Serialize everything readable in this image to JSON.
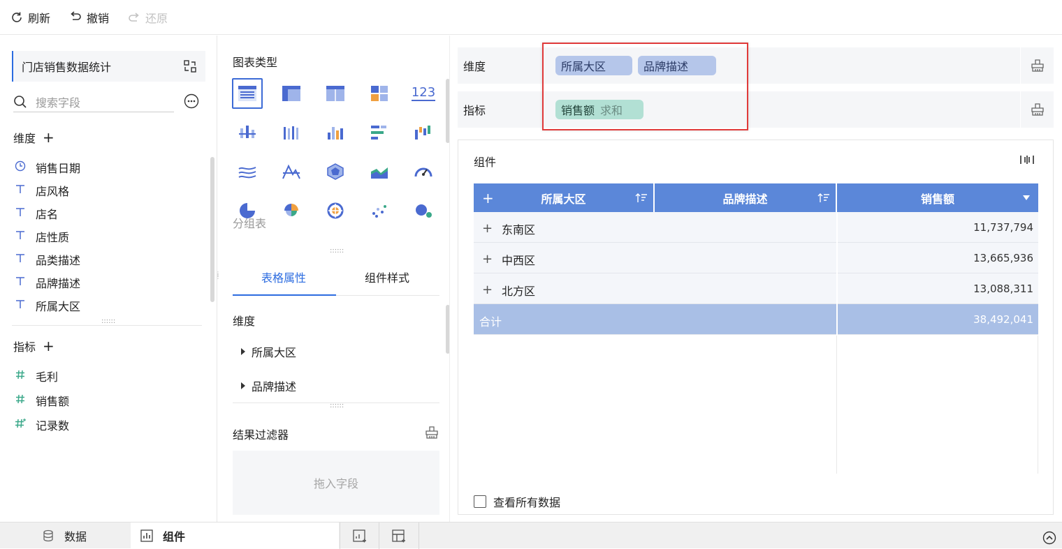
{
  "toolbar": {
    "refresh": "刷新",
    "undo": "撤销",
    "redo": "还原"
  },
  "dataset": {
    "title": "门店销售数据统计",
    "search_placeholder": "搜索字段"
  },
  "dimensions": {
    "label": "维度",
    "fields": [
      {
        "name": "销售日期",
        "icon": "clock-icon"
      },
      {
        "name": "店风格",
        "icon": "text-type-icon"
      },
      {
        "name": "店名",
        "icon": "text-type-icon"
      },
      {
        "name": "店性质",
        "icon": "text-type-icon"
      },
      {
        "name": "品类描述",
        "icon": "text-type-icon"
      },
      {
        "name": "品牌描述",
        "icon": "text-type-icon"
      },
      {
        "name": "所属大区",
        "icon": "text-type-icon"
      }
    ]
  },
  "measures": {
    "label": "指标",
    "fields": [
      {
        "name": "毛利",
        "icon": "number-type-icon"
      },
      {
        "name": "销售额",
        "icon": "number-type-icon"
      },
      {
        "name": "记录数",
        "icon": "count-type-icon"
      }
    ]
  },
  "chart_types": {
    "title": "图表类型",
    "tooltip": "分组表",
    "types": [
      "grouped-table",
      "cross-table",
      "detail-table",
      "kpi-card",
      "number-text",
      "grouped-bar",
      "stacked-column",
      "multi-series-column",
      "horizontal-bar",
      "waterfall",
      "area-line",
      "radial-line",
      "radar",
      "area",
      "gauge",
      "pie",
      "rose-pie",
      "multi-pie",
      "scatter",
      "bubble"
    ],
    "number_label": "123"
  },
  "prop_tabs": {
    "active": "表格属性",
    "other": "组件样式"
  },
  "props": {
    "dimension_label": "维度",
    "tree": [
      "所属大区",
      "品牌描述"
    ],
    "filter_label": "结果过滤器",
    "drop_placeholder": "拖入字段"
  },
  "config": {
    "dim_label": "维度",
    "dim_chips": [
      "所属大区",
      "品牌描述"
    ],
    "measure_label": "指标",
    "measure_chip": {
      "name": "销售额",
      "agg": "求和"
    }
  },
  "component": {
    "title": "组件",
    "columns": [
      "所属大区",
      "品牌描述",
      "销售额"
    ],
    "rows": [
      {
        "region": "东南区",
        "sales": "11,737,794"
      },
      {
        "region": "中西区",
        "sales": "13,665,936"
      },
      {
        "region": "北方区",
        "sales": "13,088,311"
      }
    ],
    "total": {
      "label": "合计",
      "sales": "38,492,041"
    },
    "view_all": "查看所有数据"
  },
  "bottom_tabs": {
    "data": "数据",
    "component": "组件"
  },
  "colors": {
    "accent": "#2c6ce0",
    "header": "#5b87d9",
    "dim_chip": "#b5c6ea",
    "measure_chip": "#b2e0d4",
    "highlight": "#e03a3a"
  }
}
